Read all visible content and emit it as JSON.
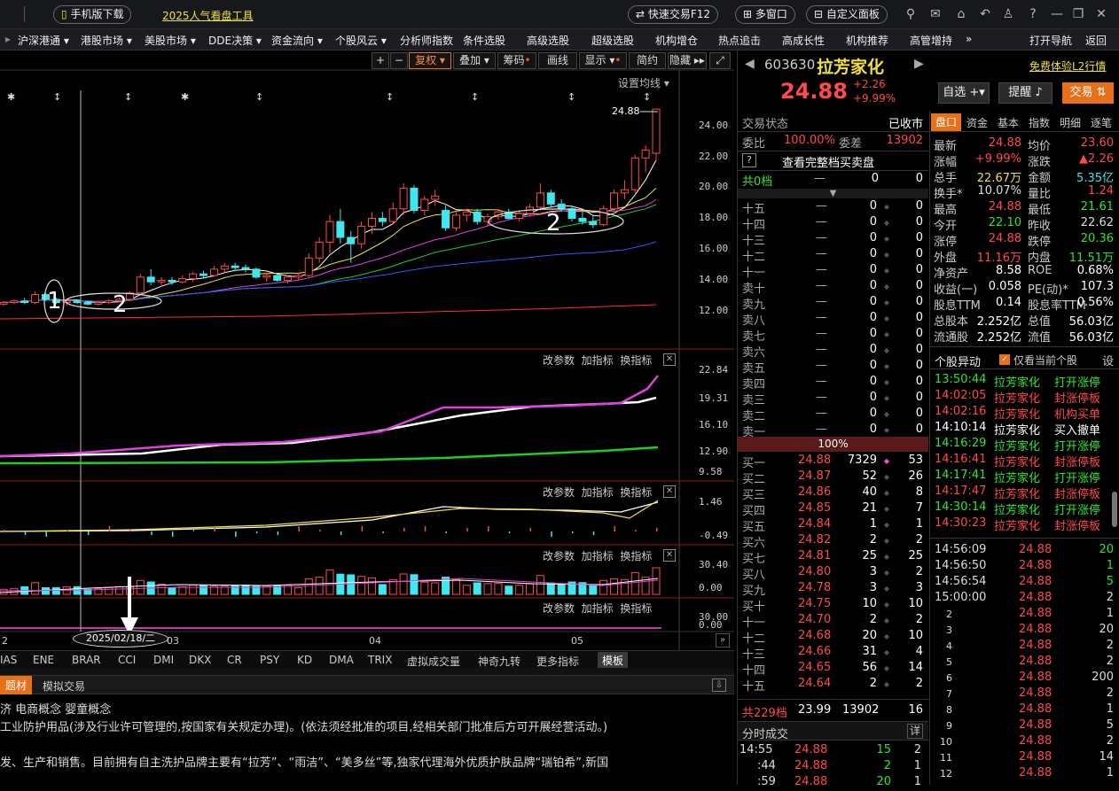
{
  "topbar": {
    "mobile_download": "手机版下载",
    "promo_link": "2025人气看盘工具",
    "quick_trade": "快速交易F12",
    "multi_window": "多窗口",
    "custom_panel": "自定义面板"
  },
  "menu": [
    "沪深港通",
    "港股市场",
    "美股市场",
    "DDE决策",
    "资金流向",
    "个股风云",
    "分析师指数",
    "条件选股",
    "高级选股",
    "超级选股",
    "机构增仓",
    "热点追击",
    "高成长性",
    "机构推荐",
    "高管增持",
    "»",
    "打开导航",
    "返回"
  ],
  "chart_toolbar": [
    "+",
    "−",
    "复权",
    "叠加",
    "筹码",
    "画线",
    "显示",
    "简约",
    "隐藏"
  ],
  "ma_setting": "设置均线",
  "price_axis": [
    "24.00",
    "22.00",
    "20.00",
    "18.00",
    "16.00",
    "14.00",
    "12.00"
  ],
  "last_price_tag": "24.88",
  "annotations": [
    "1",
    "2",
    "2"
  ],
  "panel_actions": {
    "modify": "改参数",
    "add": "加指标",
    "switch": "换指标"
  },
  "ind1_axis": [
    "22.84",
    "19.31",
    "16.10",
    "12.90",
    "9.58"
  ],
  "ind2_axis": [
    "1.46",
    "-0.49"
  ],
  "ind3_axis": [
    "30.40",
    "0.00"
  ],
  "ind4_axis": [
    "30.00",
    "0.00"
  ],
  "date_axis": {
    "left": "2",
    "cursor_date": "2025/02/18/二",
    "m03": "03",
    "m04": "04",
    "m05": "05"
  },
  "indicators": [
    "IAS",
    "ENE",
    "BRAR",
    "CCI",
    "DMI",
    "DKX",
    "CR",
    "PSY",
    "KD",
    "DMA",
    "TRIX",
    "虚拟成交量",
    "神奇九转",
    "更多指标",
    "模板"
  ],
  "tabs": [
    "题材",
    "模拟交易"
  ],
  "info_lines": [
    "济  电商概念  婴童概念",
    "工业防护用品(涉及行业许可管理的,按国家有关规定办理)。(依法须经批准的项目,经相关部门批准后方可开展经营活动。)",
    "发、生产和销售。目前拥有自主洗护品牌主要有“拉芳”、“雨洁”、“美多丝”等,独家代理海外优质护肤品牌“瑞铂希”,新国"
  ],
  "stock": {
    "code": "603630",
    "name": "拉芳家化",
    "price": "24.88",
    "change": "+2.26",
    "change_pct": "+9.99%",
    "l2_link": "免费体验L2行情",
    "btn_watch": "自选",
    "btn_alert": "提醒",
    "btn_trade": "交易"
  },
  "orderbook": {
    "status_label": "交易状态",
    "status_value": "已收市",
    "ratio_label": "委比",
    "ratio_value": "100.00%",
    "diff_label": "委差",
    "diff_value": "13902",
    "full_book": "查看完整档买卖盘",
    "sell_total_label": "共0档",
    "sell_total_dash": "—",
    "sell_total_v1": "0",
    "sell_total_v2": "0",
    "sells": [
      {
        "label": "十五",
        "price": "—",
        "vol": "0",
        "cnt": "0"
      },
      {
        "label": "十四",
        "price": "—",
        "vol": "0",
        "cnt": "0"
      },
      {
        "label": "十三",
        "price": "—",
        "vol": "0",
        "cnt": "0"
      },
      {
        "label": "十二",
        "price": "—",
        "vol": "0",
        "cnt": "0"
      },
      {
        "label": "十一",
        "price": "—",
        "vol": "0",
        "cnt": "0"
      },
      {
        "label": "卖十",
        "price": "—",
        "vol": "0",
        "cnt": "0"
      },
      {
        "label": "卖九",
        "price": "—",
        "vol": "0",
        "cnt": "0"
      },
      {
        "label": "卖八",
        "price": "—",
        "vol": "0",
        "cnt": "0"
      },
      {
        "label": "卖七",
        "price": "—",
        "vol": "0",
        "cnt": "0"
      },
      {
        "label": "卖六",
        "price": "—",
        "vol": "0",
        "cnt": "0"
      },
      {
        "label": "卖五",
        "price": "—",
        "vol": "0",
        "cnt": "0"
      },
      {
        "label": "卖四",
        "price": "—",
        "vol": "0",
        "cnt": "0"
      },
      {
        "label": "卖三",
        "price": "—",
        "vol": "0",
        "cnt": "0"
      },
      {
        "label": "卖二",
        "price": "—",
        "vol": "0",
        "cnt": "0"
      },
      {
        "label": "卖一",
        "price": "—",
        "vol": "0",
        "cnt": "0"
      }
    ],
    "mid_pct": "100%",
    "buys": [
      {
        "label": "买一",
        "price": "24.88",
        "vol": "7329",
        "cnt": "53"
      },
      {
        "label": "买二",
        "price": "24.87",
        "vol": "52",
        "cnt": "26"
      },
      {
        "label": "买三",
        "price": "24.86",
        "vol": "40",
        "cnt": "8"
      },
      {
        "label": "买四",
        "price": "24.85",
        "vol": "21",
        "cnt": "7"
      },
      {
        "label": "买五",
        "price": "24.84",
        "vol": "1",
        "cnt": "1"
      },
      {
        "label": "买六",
        "price": "24.82",
        "vol": "2",
        "cnt": "2"
      },
      {
        "label": "买七",
        "price": "24.81",
        "vol": "25",
        "cnt": "25"
      },
      {
        "label": "买八",
        "price": "24.80",
        "vol": "3",
        "cnt": "2"
      },
      {
        "label": "买九",
        "price": "24.78",
        "vol": "3",
        "cnt": "3"
      },
      {
        "label": "买十",
        "price": "24.75",
        "vol": "10",
        "cnt": "10"
      },
      {
        "label": "十一",
        "price": "24.70",
        "vol": "2",
        "cnt": "2"
      },
      {
        "label": "十二",
        "price": "24.68",
        "vol": "20",
        "cnt": "10"
      },
      {
        "label": "十三",
        "price": "24.66",
        "vol": "31",
        "cnt": "4"
      },
      {
        "label": "十四",
        "price": "24.65",
        "vol": "56",
        "cnt": "14"
      },
      {
        "label": "十五",
        "price": "24.64",
        "vol": "2",
        "cnt": "2"
      }
    ],
    "buy_total_label": "共229档",
    "buy_total_price": "23.99",
    "buy_total_vol": "13902",
    "buy_total_cnt": "16",
    "ticks_title": "分时成交",
    "ticks_btn": "详",
    "ticks": [
      {
        "time": "14:55",
        "price": "24.88",
        "vol": "15",
        "cnt": "2"
      },
      {
        "time": ":44",
        "price": "24.88",
        "vol": "2",
        "cnt": "1"
      },
      {
        "time": ":59",
        "price": "24.88",
        "vol": "20",
        "cnt": "1"
      }
    ]
  },
  "quote_tabs": [
    "盘口",
    "资金",
    "基本",
    "指数",
    "明细",
    "逐笔"
  ],
  "quote": [
    {
      "l1": "最新",
      "v1": "24.88",
      "l2": "均价",
      "v2": "23.60"
    },
    {
      "l1": "涨幅",
      "v1": "+9.99%",
      "l2": "涨跌",
      "v2": "▲2.26"
    },
    {
      "l1": "总手",
      "v1": "22.67万",
      "l2": "金额",
      "v2": "5.35亿"
    },
    {
      "l1": "换手*",
      "v1": "10.07%",
      "l2": "量比",
      "v2": "1.24"
    },
    {
      "l1": "最高",
      "v1": "24.88",
      "l2": "最低",
      "v2": "21.61"
    },
    {
      "l1": "今开",
      "v1": "22.10",
      "l2": "昨收",
      "v2": "22.62"
    },
    {
      "l1": "涨停",
      "v1": "24.88",
      "l2": "跌停",
      "v2": "20.36"
    },
    {
      "l1": "外盘",
      "v1": "11.16万",
      "l2": "内盘",
      "v2": "11.51万"
    },
    {
      "l1": "净资产",
      "v1": "8.58",
      "l2": "ROE",
      "v2": "0.68%"
    },
    {
      "l1": "收益(一)",
      "v1": "0.058",
      "l2": "PE(动)*",
      "v2": "107.3"
    },
    {
      "l1": "股息TTM",
      "v1": "0.14",
      "l2": "股息率TTM",
      "v2": "0.56%"
    },
    {
      "l1": "总股本",
      "v1": "2.252亿",
      "l2": "总值",
      "v2": "56.03亿"
    },
    {
      "l1": "流通股",
      "v1": "2.252亿",
      "l2": "流值",
      "v2": "56.03亿"
    }
  ],
  "anomaly": {
    "title": "个股异动",
    "only_current": "仅看当前个股",
    "settings": "设",
    "items": [
      {
        "time": "13:50:44",
        "name": "拉芳家化",
        "event": "打开涨停",
        "color": "#2ee62e"
      },
      {
        "time": "14:02:05",
        "name": "拉芳家化",
        "event": "封涨停板",
        "color": "#ff4a4a"
      },
      {
        "time": "14:02:16",
        "name": "拉芳家化",
        "event": "机构买单",
        "color": "#ff4a4a"
      },
      {
        "time": "14:10:14",
        "name": "拉芳家化",
        "event": "买入撤单",
        "color": "#ffffff"
      },
      {
        "time": "14:16:29",
        "name": "拉芳家化",
        "event": "打开涨停",
        "color": "#2ee62e"
      },
      {
        "time": "14:16:41",
        "name": "拉芳家化",
        "event": "封涨停板",
        "color": "#ff4a4a"
      },
      {
        "time": "14:17:41",
        "name": "拉芳家化",
        "event": "打开涨停",
        "color": "#2ee62e"
      },
      {
        "time": "14:17:47",
        "name": "拉芳家化",
        "event": "封涨停板",
        "color": "#ff4a4a"
      },
      {
        "time": "14:30:14",
        "name": "拉芳家化",
        "event": "打开涨停",
        "color": "#2ee62e"
      },
      {
        "time": "14:30:23",
        "name": "拉芳家化",
        "event": "封涨停板",
        "color": "#ff4a4a"
      }
    ]
  },
  "details": [
    {
      "t": "14:56:09",
      "p": "24.88",
      "v": "20",
      "vc": "#2ee62e"
    },
    {
      "t": "14:56:50",
      "p": "24.88",
      "v": "1",
      "vc": "#2ee62e"
    },
    {
      "t": "14:56:54",
      "p": "24.88",
      "v": "5",
      "vc": "#2ee62e"
    },
    {
      "t": "15:00:00",
      "p": "24.88",
      "v": "2",
      "vc": "#ddd"
    },
    {
      "t": "2",
      "p": "24.88",
      "v": "1",
      "vc": "#ddd"
    },
    {
      "t": "3",
      "p": "24.88",
      "v": "20",
      "vc": "#ddd"
    },
    {
      "t": "4",
      "p": "24.88",
      "v": "2",
      "vc": "#ddd"
    },
    {
      "t": "5",
      "p": "24.88",
      "v": "2",
      "vc": "#ddd"
    },
    {
      "t": "6",
      "p": "24.88",
      "v": "200",
      "vc": "#ddd"
    },
    {
      "t": "7",
      "p": "24.88",
      "v": "2",
      "vc": "#ddd"
    },
    {
      "t": "8",
      "p": "24.88",
      "v": "1",
      "vc": "#ddd"
    },
    {
      "t": "9",
      "p": "24.88",
      "v": "5",
      "vc": "#ddd"
    },
    {
      "t": "10",
      "p": "24.88",
      "v": "2",
      "vc": "#ddd"
    },
    {
      "t": "11",
      "p": "24.88",
      "v": "14",
      "vc": "#ddd"
    },
    {
      "t": "12",
      "p": "24.88",
      "v": "1",
      "vc": "#ddd"
    }
  ],
  "colors": {
    "up": "#ff4a4a",
    "down": "#3ee8ee",
    "accent": "#e8701a"
  },
  "chart_data": {
    "type": "candlestick",
    "ylim": [
      11,
      25.5
    ],
    "ohlc": [
      [
        12.6,
        12.8,
        12.5,
        12.7
      ],
      [
        12.7,
        12.9,
        12.6,
        12.8
      ],
      [
        12.8,
        13.0,
        12.6,
        12.7
      ],
      [
        12.7,
        13.4,
        12.6,
        13.2
      ],
      [
        13.2,
        13.3,
        12.8,
        12.9
      ],
      [
        12.9,
        13.0,
        12.6,
        12.7
      ],
      [
        12.7,
        12.9,
        12.5,
        12.8
      ],
      [
        12.8,
        12.9,
        12.6,
        12.7
      ],
      [
        12.7,
        12.8,
        12.5,
        12.6
      ],
      [
        12.6,
        12.8,
        12.5,
        12.7
      ],
      [
        12.7,
        12.9,
        12.6,
        12.8
      ],
      [
        12.8,
        13.0,
        12.7,
        12.9
      ],
      [
        12.9,
        13.4,
        12.8,
        13.3
      ],
      [
        13.3,
        14.5,
        13.2,
        14.3
      ],
      [
        14.3,
        14.8,
        13.8,
        14.0
      ],
      [
        14.0,
        14.3,
        13.7,
        14.1
      ],
      [
        14.1,
        14.3,
        13.8,
        14.0
      ],
      [
        14.0,
        14.4,
        13.9,
        14.2
      ],
      [
        14.2,
        14.6,
        14.0,
        14.5
      ],
      [
        14.5,
        14.7,
        14.2,
        14.4
      ],
      [
        14.4,
        15.0,
        14.3,
        14.8
      ],
      [
        14.8,
        15.2,
        14.6,
        15.0
      ],
      [
        15.0,
        15.2,
        14.7,
        14.9
      ],
      [
        14.9,
        15.1,
        14.6,
        14.8
      ],
      [
        14.8,
        14.9,
        14.2,
        14.3
      ],
      [
        14.3,
        14.6,
        14.0,
        14.4
      ],
      [
        14.4,
        14.5,
        14.0,
        14.1
      ],
      [
        14.1,
        14.4,
        13.9,
        14.3
      ],
      [
        14.3,
        14.6,
        14.1,
        14.4
      ],
      [
        14.4,
        15.8,
        14.3,
        15.5
      ],
      [
        15.5,
        16.8,
        15.2,
        16.5
      ],
      [
        16.5,
        18.2,
        15.8,
        17.8
      ],
      [
        17.8,
        18.6,
        16.4,
        16.8
      ],
      [
        16.8,
        17.2,
        15.2,
        16.4
      ],
      [
        16.4,
        17.8,
        16.1,
        17.5
      ],
      [
        17.5,
        18.4,
        17.0,
        18.0
      ],
      [
        18.0,
        18.4,
        17.5,
        17.8
      ],
      [
        17.8,
        19.0,
        17.6,
        18.6
      ],
      [
        18.6,
        20.2,
        18.2,
        19.9
      ],
      [
        19.9,
        20.1,
        18.3,
        18.5
      ],
      [
        18.5,
        19.4,
        18.2,
        19.2
      ],
      [
        19.2,
        19.8,
        18.8,
        19.4
      ],
      [
        18.5,
        18.8,
        17.2,
        17.4
      ],
      [
        17.4,
        18.4,
        17.2,
        18.2
      ],
      [
        18.2,
        18.6,
        17.8,
        18.4
      ],
      [
        18.4,
        18.6,
        17.6,
        17.8
      ],
      [
        17.8,
        18.3,
        17.5,
        18.1
      ],
      [
        18.1,
        18.6,
        17.9,
        18.4
      ],
      [
        18.4,
        18.6,
        17.9,
        18.0
      ],
      [
        18.0,
        18.5,
        17.8,
        18.3
      ],
      [
        18.3,
        18.9,
        18.1,
        18.7
      ],
      [
        18.7,
        20.2,
        18.5,
        19.6
      ],
      [
        19.6,
        19.8,
        18.7,
        18.9
      ],
      [
        18.9,
        19.2,
        18.4,
        18.6
      ],
      [
        18.6,
        18.8,
        17.8,
        18.0
      ],
      [
        18.0,
        18.4,
        17.6,
        17.8
      ],
      [
        17.8,
        18.2,
        17.4,
        17.6
      ],
      [
        17.6,
        18.8,
        17.5,
        18.6
      ],
      [
        18.6,
        19.8,
        18.4,
        19.6
      ],
      [
        19.6,
        20.4,
        19.2,
        19.8
      ],
      [
        19.8,
        22.0,
        19.6,
        21.8
      ],
      [
        21.8,
        22.6,
        20.9,
        22.3
      ],
      [
        22.1,
        24.88,
        21.61,
        24.88
      ]
    ]
  }
}
